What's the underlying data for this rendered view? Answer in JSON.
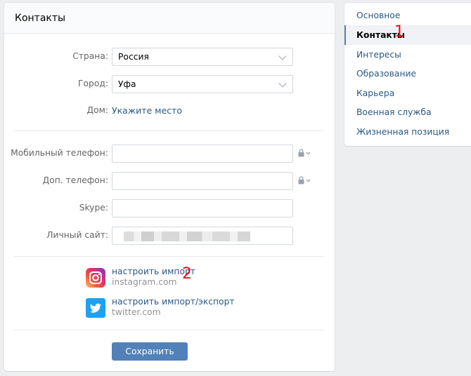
{
  "panel": {
    "title": "Контакты"
  },
  "form": {
    "country_label": "Страна:",
    "country_value": "Россия",
    "city_label": "Город:",
    "city_value": "Уфа",
    "home_label": "Дом:",
    "home_link": "Укажите место",
    "mobile_label": "Мобильный телефон:",
    "extra_phone_label": "Доп. телефон:",
    "skype_label": "Skype:",
    "website_label": "Личный сайт:"
  },
  "social": {
    "instagram": {
      "action": "настроить импорт",
      "domain": "instagram.com",
      "icon": "instagram-icon",
      "color": "#c13584"
    },
    "twitter": {
      "action": "настроить импорт/экспорт",
      "domain": "twitter.com",
      "icon": "twitter-icon",
      "color": "#1da1f2"
    }
  },
  "save_button": "Сохранить",
  "annotations": {
    "first": "1",
    "second": "2"
  },
  "menu": {
    "items": [
      {
        "label": "Основное"
      },
      {
        "label": "Контакты",
        "active": true
      },
      {
        "label": "Интересы"
      },
      {
        "label": "Образование"
      },
      {
        "label": "Карьера"
      },
      {
        "label": "Военная служба"
      },
      {
        "label": "Жизненная позиция"
      }
    ]
  },
  "colors": {
    "accent": "#5181b8",
    "link": "#2a5885",
    "background": "#edeef0",
    "annotation": "#ee1111"
  }
}
